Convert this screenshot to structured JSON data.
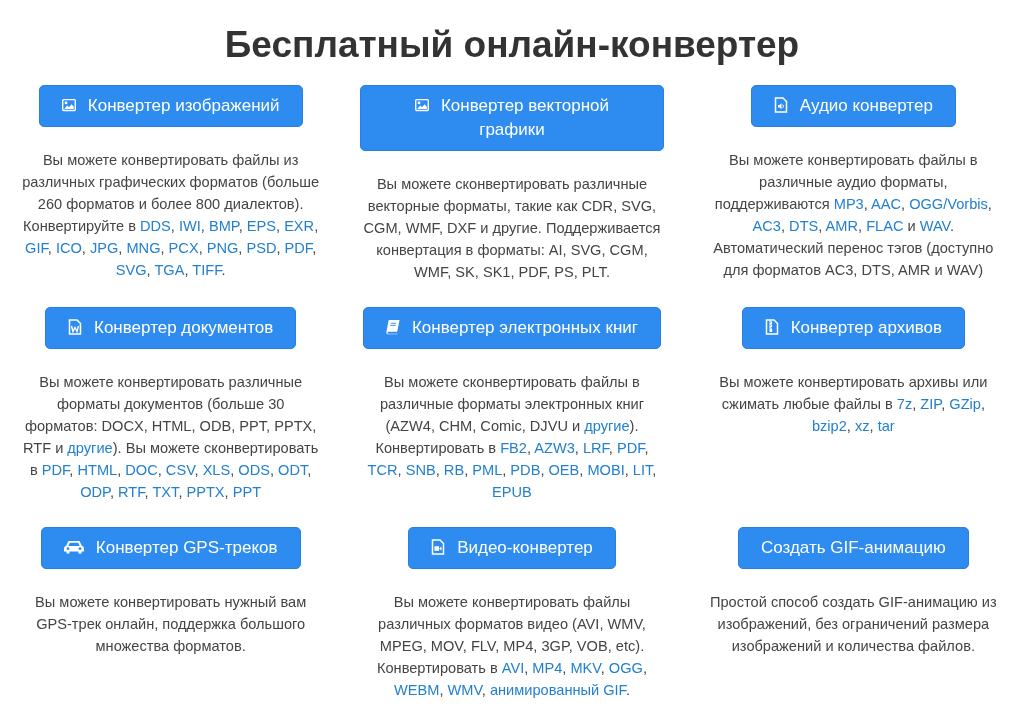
{
  "page": {
    "title": "Бесплатный онлайн-конвертер"
  },
  "cards": [
    {
      "button": "Конвертер изображений",
      "description": [
        {
          "kind": "text",
          "text": "Вы можете конвертировать файлы из различных графических форматов (больше 260 форматов и более 800 диалектов). Конвертируйте в "
        },
        {
          "kind": "link",
          "text": "DDS"
        },
        {
          "kind": "text",
          "text": ", "
        },
        {
          "kind": "link",
          "text": "IWI"
        },
        {
          "kind": "text",
          "text": ", "
        },
        {
          "kind": "link",
          "text": "BMP"
        },
        {
          "kind": "text",
          "text": ", "
        },
        {
          "kind": "link",
          "text": "EPS"
        },
        {
          "kind": "text",
          "text": ", "
        },
        {
          "kind": "link",
          "text": "EXR"
        },
        {
          "kind": "text",
          "text": ", "
        },
        {
          "kind": "link",
          "text": "GIF"
        },
        {
          "kind": "text",
          "text": ", "
        },
        {
          "kind": "link",
          "text": "ICO"
        },
        {
          "kind": "text",
          "text": ", "
        },
        {
          "kind": "link",
          "text": "JPG"
        },
        {
          "kind": "text",
          "text": ", "
        },
        {
          "kind": "link",
          "text": "MNG"
        },
        {
          "kind": "text",
          "text": ", "
        },
        {
          "kind": "link",
          "text": "PCX"
        },
        {
          "kind": "text",
          "text": ", "
        },
        {
          "kind": "link",
          "text": "PNG"
        },
        {
          "kind": "text",
          "text": ", "
        },
        {
          "kind": "link",
          "text": "PSD"
        },
        {
          "kind": "text",
          "text": ", "
        },
        {
          "kind": "link",
          "text": "PDF"
        },
        {
          "kind": "text",
          "text": ", "
        },
        {
          "kind": "link",
          "text": "SVG"
        },
        {
          "kind": "text",
          "text": ", "
        },
        {
          "kind": "link",
          "text": "TGA"
        },
        {
          "kind": "text",
          "text": ", "
        },
        {
          "kind": "link",
          "text": "TIFF"
        },
        {
          "kind": "text",
          "text": "."
        }
      ]
    },
    {
      "button": "Конвертер векторной графики",
      "description": [
        {
          "kind": "text",
          "text": "Вы можете сконвертировать различные векторные форматы, такие как CDR, SVG, CGM, WMF, DXF и другие. Поддерживается конвертация в форматы: AI, SVG, CGM, WMF, SK, SK1, PDF, PS, PLT."
        }
      ]
    },
    {
      "button": "Аудио конвертер",
      "description": [
        {
          "kind": "text",
          "text": "Вы можете конвертировать файлы в различные аудио форматы, поддерживаются "
        },
        {
          "kind": "link",
          "text": "MP3"
        },
        {
          "kind": "text",
          "text": ", "
        },
        {
          "kind": "link",
          "text": "AAC"
        },
        {
          "kind": "text",
          "text": ", "
        },
        {
          "kind": "link",
          "text": "OGG/Vorbis"
        },
        {
          "kind": "text",
          "text": ", "
        },
        {
          "kind": "link",
          "text": "AC3"
        },
        {
          "kind": "text",
          "text": ", "
        },
        {
          "kind": "link",
          "text": "DTS"
        },
        {
          "kind": "text",
          "text": ", "
        },
        {
          "kind": "link",
          "text": "AMR"
        },
        {
          "kind": "text",
          "text": ", "
        },
        {
          "kind": "link",
          "text": "FLAC"
        },
        {
          "kind": "text",
          "text": " и "
        },
        {
          "kind": "link",
          "text": "WAV"
        },
        {
          "kind": "text",
          "text": ". Автоматический перенос тэгов (доступно для форматов AC3, DTS, AMR и WAV)"
        }
      ]
    },
    {
      "button": "Конвертер документов",
      "description": [
        {
          "kind": "text",
          "text": "Вы можете конвертировать различные форматы документов (больше 30 форматов: DOCX, HTML, ODB, PPT, PPTX, RTF и "
        },
        {
          "kind": "link",
          "text": "другие"
        },
        {
          "kind": "text",
          "text": "). Вы можете сконвертировать в "
        },
        {
          "kind": "link",
          "text": "PDF"
        },
        {
          "kind": "text",
          "text": ", "
        },
        {
          "kind": "link",
          "text": "HTML"
        },
        {
          "kind": "text",
          "text": ", "
        },
        {
          "kind": "link",
          "text": "DOC"
        },
        {
          "kind": "text",
          "text": ", "
        },
        {
          "kind": "link",
          "text": "CSV"
        },
        {
          "kind": "text",
          "text": ", "
        },
        {
          "kind": "link",
          "text": "XLS"
        },
        {
          "kind": "text",
          "text": ", "
        },
        {
          "kind": "link",
          "text": "ODS"
        },
        {
          "kind": "text",
          "text": ", "
        },
        {
          "kind": "link",
          "text": "ODT"
        },
        {
          "kind": "text",
          "text": ", "
        },
        {
          "kind": "link",
          "text": "ODP"
        },
        {
          "kind": "text",
          "text": ", "
        },
        {
          "kind": "link",
          "text": "RTF"
        },
        {
          "kind": "text",
          "text": ", "
        },
        {
          "kind": "link",
          "text": "TXT"
        },
        {
          "kind": "text",
          "text": ", "
        },
        {
          "kind": "link",
          "text": "PPTX"
        },
        {
          "kind": "text",
          "text": ", "
        },
        {
          "kind": "link",
          "text": "PPT"
        }
      ]
    },
    {
      "button": "Конвертер электронных книг",
      "description": [
        {
          "kind": "text",
          "text": "Вы можете сконвертировать файлы в различные форматы электронных книг (AZW4, CHM, Comic, DJVU и "
        },
        {
          "kind": "link",
          "text": "другие"
        },
        {
          "kind": "text",
          "text": "). Конвертировать в "
        },
        {
          "kind": "link",
          "text": "FB2"
        },
        {
          "kind": "text",
          "text": ", "
        },
        {
          "kind": "link",
          "text": "AZW3"
        },
        {
          "kind": "text",
          "text": ", "
        },
        {
          "kind": "link",
          "text": "LRF"
        },
        {
          "kind": "text",
          "text": ", "
        },
        {
          "kind": "link",
          "text": "PDF"
        },
        {
          "kind": "text",
          "text": ", "
        },
        {
          "kind": "link",
          "text": "TCR"
        },
        {
          "kind": "text",
          "text": ", "
        },
        {
          "kind": "link",
          "text": "SNB"
        },
        {
          "kind": "text",
          "text": ", "
        },
        {
          "kind": "link",
          "text": "RB"
        },
        {
          "kind": "text",
          "text": ", "
        },
        {
          "kind": "link",
          "text": "PML"
        },
        {
          "kind": "text",
          "text": ", "
        },
        {
          "kind": "link",
          "text": "PDB"
        },
        {
          "kind": "text",
          "text": ", "
        },
        {
          "kind": "link",
          "text": "OEB"
        },
        {
          "kind": "text",
          "text": ", "
        },
        {
          "kind": "link",
          "text": "MOBI"
        },
        {
          "kind": "text",
          "text": ", "
        },
        {
          "kind": "link",
          "text": "LIT"
        },
        {
          "kind": "text",
          "text": ", "
        },
        {
          "kind": "link",
          "text": "EPUB"
        }
      ]
    },
    {
      "button": "Конвертер архивов",
      "description": [
        {
          "kind": "text",
          "text": "Вы можете конвертировать архивы или сжимать любые файлы в "
        },
        {
          "kind": "link",
          "text": "7z"
        },
        {
          "kind": "text",
          "text": ", "
        },
        {
          "kind": "link",
          "text": "ZIP"
        },
        {
          "kind": "text",
          "text": ", "
        },
        {
          "kind": "link",
          "text": "GZip"
        },
        {
          "kind": "text",
          "text": ", "
        },
        {
          "kind": "link",
          "text": "bzip2"
        },
        {
          "kind": "text",
          "text": ", "
        },
        {
          "kind": "link",
          "text": "xz"
        },
        {
          "kind": "text",
          "text": ", "
        },
        {
          "kind": "link",
          "text": "tar"
        }
      ]
    },
    {
      "button": "Конвертер GPS-треков",
      "description": [
        {
          "kind": "text",
          "text": "Вы можете конвертировать нужный вам GPS-трек онлайн, поддержка большого множества форматов."
        }
      ]
    },
    {
      "button": "Видео-конвертер",
      "description": [
        {
          "kind": "text",
          "text": "Вы можете конвертировать файлы различных форматов видео (AVI, WMV, MPEG, MOV, FLV, MP4, 3GP, VOB, etc). Конвертировать в "
        },
        {
          "kind": "link",
          "text": "AVI"
        },
        {
          "kind": "text",
          "text": ", "
        },
        {
          "kind": "link",
          "text": "MP4"
        },
        {
          "kind": "text",
          "text": ", "
        },
        {
          "kind": "link",
          "text": "MKV"
        },
        {
          "kind": "text",
          "text": ", "
        },
        {
          "kind": "link",
          "text": "OGG"
        },
        {
          "kind": "text",
          "text": ", "
        },
        {
          "kind": "link",
          "text": "WEBM"
        },
        {
          "kind": "text",
          "text": ", "
        },
        {
          "kind": "link",
          "text": "WMV"
        },
        {
          "kind": "text",
          "text": ", "
        },
        {
          "kind": "link",
          "text": "анимированный GIF"
        },
        {
          "kind": "text",
          "text": "."
        }
      ]
    },
    {
      "button": "Создать GIF-анимацию",
      "description": [
        {
          "kind": "text",
          "text": "Простой способ создать GIF-анимацию из изображений, без ограничений размера изображений и количества файлов."
        }
      ]
    }
  ]
}
